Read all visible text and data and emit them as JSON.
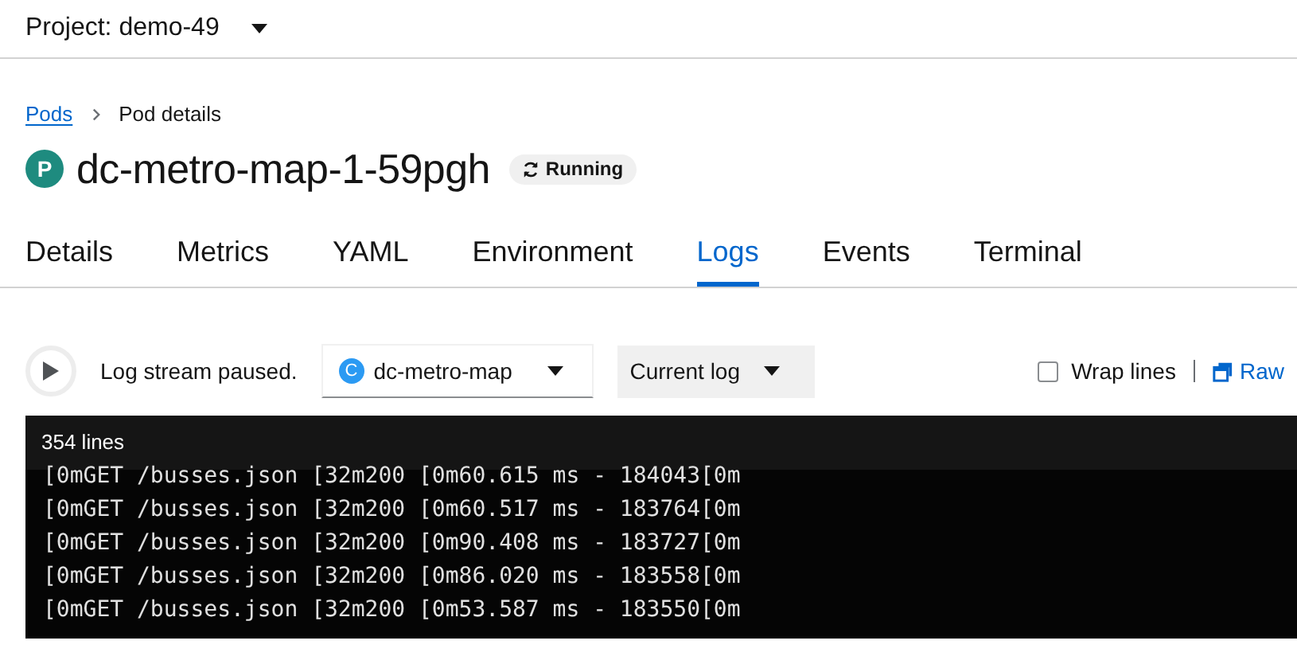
{
  "project_selector": {
    "label": "Project: demo-49"
  },
  "breadcrumb": [
    {
      "label": "Pods",
      "kind": "link"
    },
    {
      "label": "Pod details",
      "kind": "current"
    }
  ],
  "title": {
    "badge": "P",
    "name": "dc-metro-map-1-59pgh",
    "status": "Running"
  },
  "tabs": [
    {
      "label": "Details",
      "selected": false
    },
    {
      "label": "Metrics",
      "selected": false
    },
    {
      "label": "YAML",
      "selected": false
    },
    {
      "label": "Environment",
      "selected": false
    },
    {
      "label": "Logs",
      "selected": true
    },
    {
      "label": "Events",
      "selected": false
    },
    {
      "label": "Terminal",
      "selected": false
    }
  ],
  "log_toolbar": {
    "stream_status": "Log stream paused.",
    "container_badge": "C",
    "container": "dc-metro-map",
    "log_type": "Current log",
    "wrap_lines": {
      "label": "Wrap lines",
      "checked": false
    },
    "raw_link": "Raw"
  },
  "log": {
    "line_count": "354 lines",
    "lines": [
      "[0mGET /busses.json [32m200 [0m60.615 ms - 184043[0m",
      "[0mGET /busses.json [32m200 [0m60.517 ms - 183764[0m",
      "[0mGET /busses.json [32m200 [0m90.408 ms - 183727[0m",
      "[0mGET /busses.json [32m200 [0m86.020 ms - 183558[0m",
      "[0mGET /busses.json [32m200 [0m53.587 ms - 183550[0m"
    ]
  }
}
